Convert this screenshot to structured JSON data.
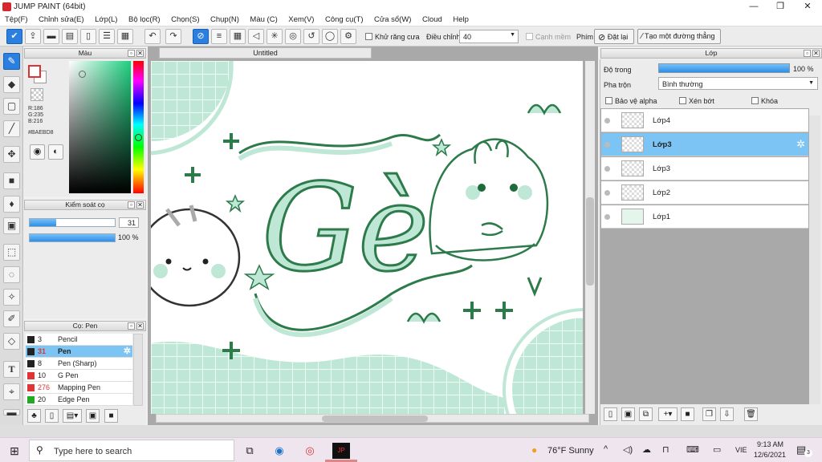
{
  "window": {
    "title": "JUMP PAINT (64bit)",
    "controls": [
      "—",
      "❐",
      "✕"
    ]
  },
  "menu": [
    "Tệp(F)",
    "Chỉnh sửa(E)",
    "Lớp(L)",
    "Bộ lọc(R)",
    "Chọn(S)",
    "Chụp(N)",
    "Màu (C)",
    "Xem(V)",
    "Công cụ(T)",
    "Cửa sổ(W)",
    "Cloud",
    "Help"
  ],
  "toolbar": {
    "antialias_label": "Khử răng cưa",
    "adjust_label": "Điều chỉnh",
    "adjust_value": "40",
    "smooth_label": "Cạnh mềm",
    "phim_label": "Phím",
    "reset_label": "Đặt lại",
    "line_label": "Tạo một đường thẳng"
  },
  "color_panel": {
    "title": "Màu",
    "r": "R:186",
    "g": "G:235",
    "b": "B:216",
    "hex": "#BAEBD8",
    "current_color": "#BAEBD8"
  },
  "brush_control": {
    "title": "Kiểm soát cọ",
    "size": "31",
    "size_fraction": 0.31,
    "opacity": "100 %",
    "opacity_fraction": 1.0
  },
  "pen_panel": {
    "title": "Cọ: Pen",
    "pens": [
      {
        "num": "3",
        "name": "Pencil",
        "color": "#222222"
      },
      {
        "num": "31",
        "name": "Pen",
        "color": "#222222"
      },
      {
        "num": "8",
        "name": "Pen (Sharp)",
        "color": "#222222"
      },
      {
        "num": "10",
        "name": "G Pen",
        "color": "#e23434"
      },
      {
        "num": "276",
        "name": "Mapping Pen",
        "color": "#e23434"
      },
      {
        "num": "20",
        "name": "Edge Pen",
        "color": "#22aa22"
      }
    ]
  },
  "document": {
    "tab": "Untitled",
    "art_text": "Gè"
  },
  "layer_panel": {
    "title": "Lớp",
    "opacity_label": "Độ trong",
    "opacity_value": "100 %",
    "blend_label": "Pha trộn",
    "blend_value": "Bình thường",
    "protect_alpha": "Bảo vệ alpha",
    "clip": "Xén bớt",
    "lock": "Khóa",
    "layers": [
      "Lớp4",
      "Lớp3",
      "Lớp3",
      "Lớp2",
      "Lớp1"
    ]
  },
  "taskbar": {
    "search_placeholder": "Type here to search",
    "weather": "76°F  Sunny",
    "lang": "VIE",
    "time": "9:13 AM",
    "date": "12/6/2021",
    "notif_count": "3"
  }
}
